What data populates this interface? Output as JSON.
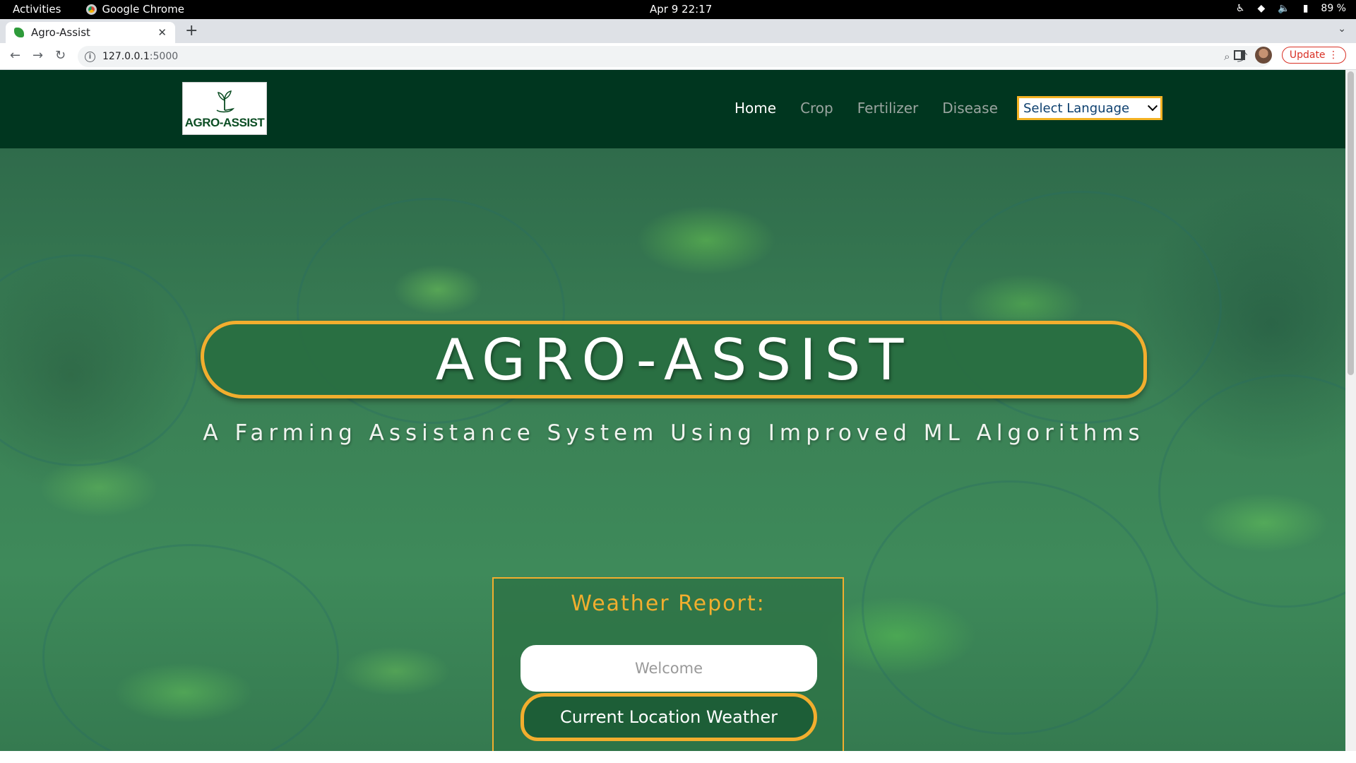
{
  "os": {
    "activities": "Activities",
    "app_name": "Google Chrome",
    "clock": "Apr 9  22:17",
    "battery": "89 %"
  },
  "browser": {
    "tab_title": "Agro-Assist",
    "url_host": "127.0.0.1",
    "url_port": ":5000",
    "update_label": "Update"
  },
  "site": {
    "logo_text": "AGRO-ASSIST",
    "nav": [
      {
        "label": "Home",
        "active": true
      },
      {
        "label": "Crop",
        "active": false
      },
      {
        "label": "Fertilizer",
        "active": false
      },
      {
        "label": "Disease",
        "active": false
      }
    ],
    "language_select": "Select Language"
  },
  "hero": {
    "title": "AGRO-ASSIST",
    "subtitle": "A Farming Assistance System Using Improved ML Algorithms"
  },
  "weather": {
    "title": "Weather Report:",
    "input_placeholder": "Welcome",
    "button_label": "Current Location Weather"
  },
  "colors": {
    "nav_bg": "#00361f",
    "accent": "#f2ae2e",
    "hero_green": "#3a8055"
  }
}
